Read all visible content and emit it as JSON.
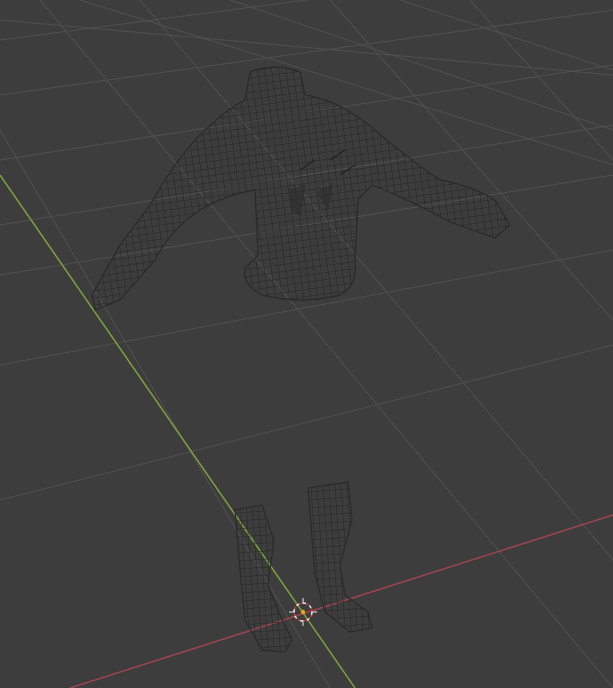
{
  "viewport": {
    "mode": "wireframe",
    "colors": {
      "background": "#3d3d3d",
      "grid": "#505050",
      "x_axis": "#9c4450",
      "y_axis": "#7aa33a",
      "wire": "#262626",
      "cursor": "#e8e8e8",
      "origin": "#f0a020"
    },
    "objects": [
      "torso-mesh",
      "left-boot-mesh",
      "right-boot-mesh"
    ]
  }
}
